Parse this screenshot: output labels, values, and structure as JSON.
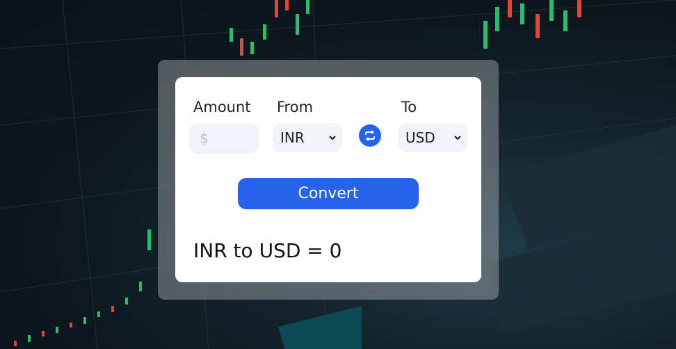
{
  "labels": {
    "amount": "Amount",
    "from": "From",
    "to": "To"
  },
  "amount_input": {
    "value": "",
    "placeholder": "$"
  },
  "from_select": {
    "selected": "INR"
  },
  "to_select": {
    "selected": "USD"
  },
  "swap_button": {
    "icon": "swap-arrows-icon"
  },
  "convert_button": {
    "label": "Convert"
  },
  "result": {
    "text": "INR to USD = 0"
  },
  "colors": {
    "accent": "#2563eb",
    "input_bg": "#f0f3f7",
    "card_bg": "#ffffff"
  }
}
